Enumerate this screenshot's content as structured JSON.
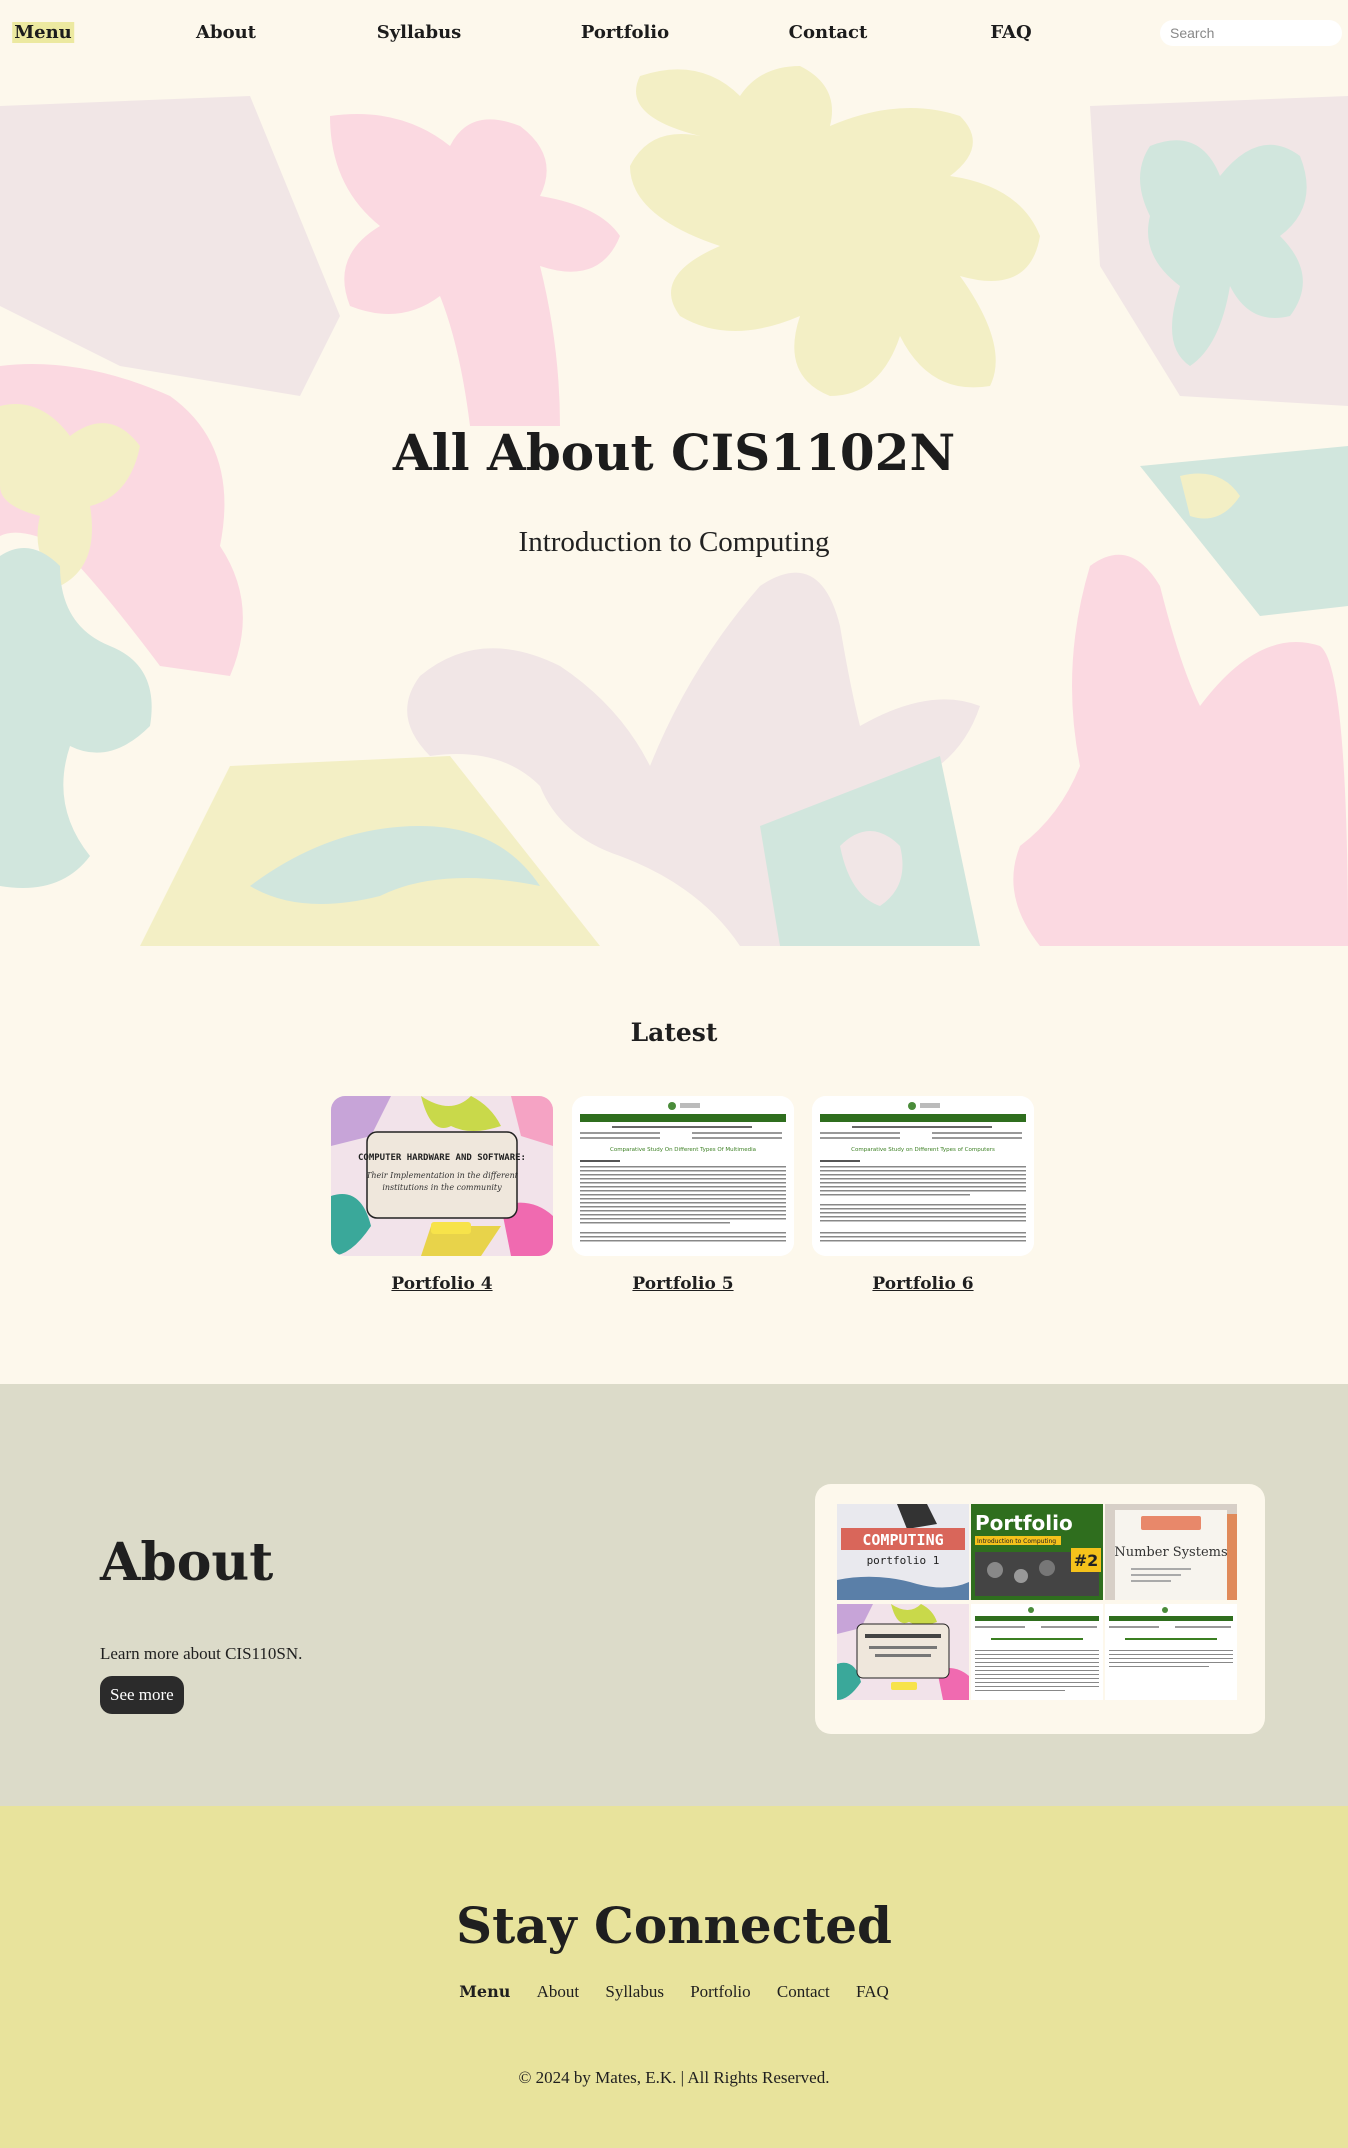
{
  "nav": {
    "menu": "Menu",
    "items": [
      "About",
      "Syllabus",
      "Portfolio",
      "Contact",
      "FAQ"
    ],
    "search_placeholder": "Search"
  },
  "hero": {
    "title": "All About CIS1102N",
    "subtitle": "Introduction to Computing"
  },
  "latest": {
    "title": "Latest",
    "cards": [
      {
        "label": "Portfolio 4",
        "thumb_title": "COMPUTER HARDWARE AND SOFTWARE:",
        "thumb_subtitle": "Their Implementation in the different institutions in the community"
      },
      {
        "label": "Portfolio 5",
        "thumb_title": "Comparative Study On Different Types Of Multimedia"
      },
      {
        "label": "Portfolio 6",
        "thumb_title": "Comparative Study on Different Types of Computers"
      }
    ]
  },
  "about": {
    "title": "About",
    "description": "Learn more about CIS110SN.",
    "button": "See more",
    "gallery": {
      "computing": "COMPUTING",
      "computing_sub": "portfolio 1",
      "portfolio": "Portfolio",
      "portfolio_sub": "Introduction to Computing",
      "portfolio_num": "#2",
      "number_systems": "Number Systems"
    }
  },
  "footer": {
    "title": "Stay Connected",
    "menu": "Menu",
    "links": [
      "About",
      "Syllabus",
      "Portfolio",
      "Contact",
      "FAQ"
    ],
    "copyright": "© 2024 by Mates, E.K. | All Rights Reserved."
  },
  "colors": {
    "background": "#fdf8ec",
    "pink": "#fbd9e1",
    "yellow": "#f3efc5",
    "mint": "#d1e6dd",
    "mauve": "#f1e6e6",
    "about_bg": "#dcdbc9",
    "footer_bg": "#e8e39c",
    "button": "#2b2b2b"
  }
}
